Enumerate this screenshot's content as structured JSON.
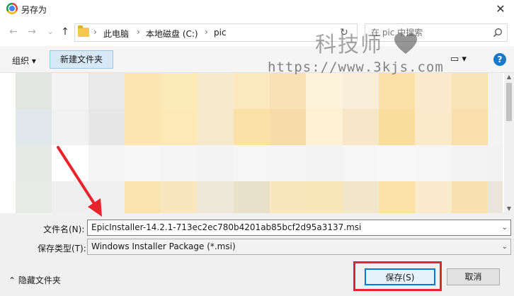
{
  "window": {
    "title": "另存为",
    "close_glyph": "✕"
  },
  "nav": {
    "back_glyph": "←",
    "forward_glyph": "→",
    "recent_glyph": "⌄",
    "up_glyph": "↑",
    "breadcrumbs": [
      "此电脑",
      "本地磁盘 (C:)",
      "pic"
    ],
    "separator": "›",
    "refresh_glyph": "↻",
    "search_placeholder": "在 pic 中搜索"
  },
  "toolbar": {
    "organize_label": "组织 ▾",
    "new_folder_label": "新建文件夹",
    "view_glyph": "▭ ▾",
    "help_glyph": "?"
  },
  "watermark": {
    "text": "科技师",
    "url": "https://www.3kjs.com"
  },
  "file_area": {
    "tile_colors": [
      "#e1e6e0",
      "#f3f3f3",
      "#e9e9e9",
      "#fbe6b3",
      "#fceab9",
      "#f6e9cc",
      "#fbe8bd",
      "#f8e2b5",
      "#fdf2da",
      "#f8eed9",
      "#fbe1a8",
      "#fbeacb",
      "#f7e3b3",
      "#f2f2f2",
      "#e0e8ec",
      "#f1f1f1",
      "#e7e7e7",
      "#fbe5b0",
      "#fce9b7",
      "#f7e9cb",
      "#f9e1a8",
      "#f6dca8",
      "#fdf0d3",
      "#f6e7c8",
      "#fbdd9f",
      "#faeac9",
      "#f8dfab",
      "#f3f3f3",
      "#e6e9e6",
      "#ffffff",
      "#f5f5f5",
      "#f7f7f7",
      "#f5f5f5",
      "#f4f4f4",
      "#f6f6f6",
      "#f5f5f5",
      "#f3f3f3",
      "#f6f6f6",
      "#f8f8f8",
      "#f6f6f6",
      "#f3f3f3",
      "#f2f2f2",
      "#e8eae6",
      "#efefef",
      "#f0f0f0",
      "#f9e3b1",
      "#f8e6c1",
      "#eee8d8",
      "#e8e0c9",
      "#f9e6bd",
      "#fae7b9",
      "#f2e6cc",
      "#fbe2a9",
      "#f9ebcc",
      "#f7e1b0",
      "#ebe6dc"
    ]
  },
  "form": {
    "filename_label": "文件名(N):",
    "filename_value": "EpicInstaller-14.2.1-713ec2ec780b4201ab85bcf2d95a3137.msi",
    "filetype_label": "保存类型(T):",
    "filetype_value": "Windows Installer Package (*.msi)",
    "dropdown_glyph": "⌄"
  },
  "footer": {
    "hide_folders_label": "⌃  隐藏文件夹",
    "save_label": "保存(S)",
    "cancel_label": "取消"
  },
  "colors": {
    "highlight_red": "#e8232b",
    "accent_blue": "#0078d7"
  }
}
